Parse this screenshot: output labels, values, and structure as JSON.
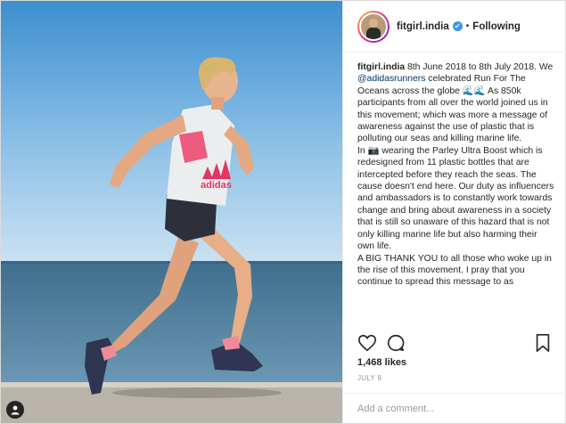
{
  "post": {
    "username": "fitgirl.india",
    "verified_glyph": "✔",
    "separator": "•",
    "follow_status": "Following",
    "caption_intro": " 8th June 2018 to 8th July 2018. We ",
    "mention": "@adidasrunners",
    "caption_mid": " celebrated Run For The Oceans across the globe 🌊🌊 As 850k participants from all over the world joined us in this movement; which was more a message of awareness against the use of plastic that is polluting our seas and killing marine life.",
    "caption_p2": "In 📷 wearing the Parley Ultra Boost which is redesigned from 11 plastic bottles that are intercepted before they reach the seas. The cause doesn't end here. Our duty as influencers and ambassadors is to constantly work towards change and bring about awareness in a society that is still so unaware of this hazard that is not only killing marine life but also harming their own life.",
    "caption_p3": "A BIG THANK YOU to all those who woke up in the rise of this movement. I pray that you continue to spread this message to as",
    "likes": "1,468 likes",
    "date": "JULY 8",
    "comment_placeholder": "Add a comment..."
  },
  "icons": {
    "like": "heart-icon",
    "comment": "comment-bubble-icon",
    "save": "bookmark-icon",
    "tag": "user-tag-icon"
  },
  "colors": {
    "link": "#003569",
    "verified": "#3897f0",
    "muted": "#999999"
  }
}
